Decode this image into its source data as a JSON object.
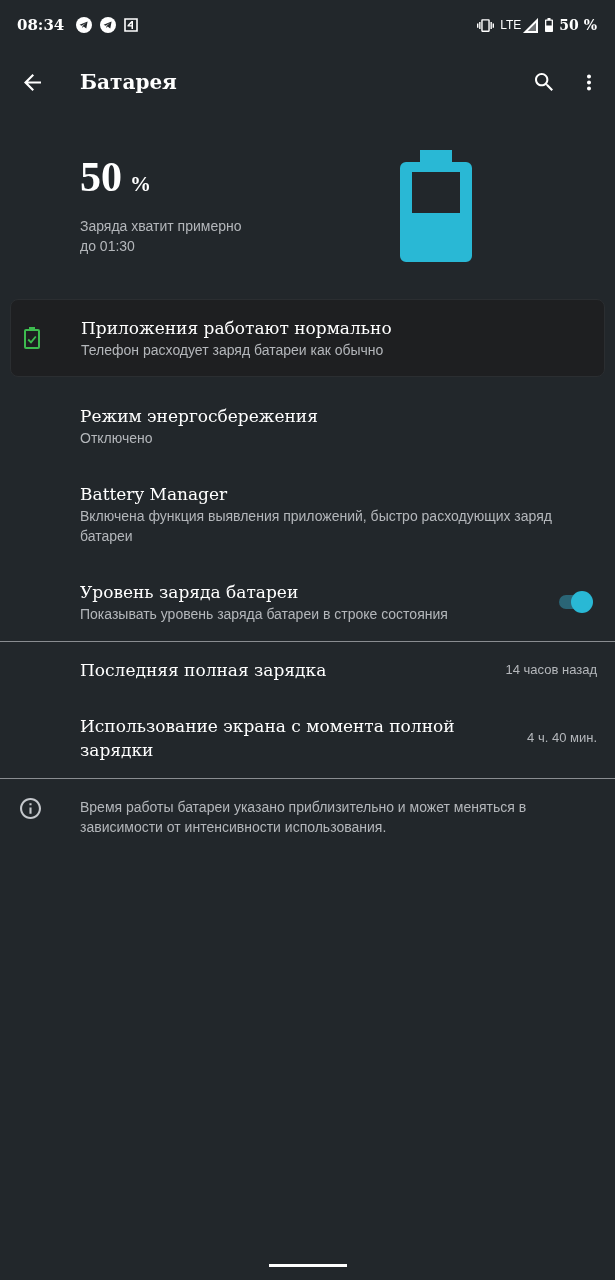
{
  "status_bar": {
    "time": "08:34",
    "network": "LTE",
    "battery": "50 %"
  },
  "toolbar": {
    "title": "Батарея"
  },
  "summary": {
    "percent": "50",
    "unit": "%",
    "estimate": "Заряда хватит примерно до 01:30"
  },
  "tip": {
    "title": "Приложения работают нормально",
    "subtitle": "Телефон расходует заряд батареи как обычно"
  },
  "settings": [
    {
      "kind": "item",
      "title": "Режим энергосбережения",
      "subtitle": "Отключено"
    },
    {
      "kind": "item",
      "title": "Battery Manager",
      "subtitle": "Включена функция выявления приложений, быстро расходующих заряд батареи"
    },
    {
      "kind": "toggle",
      "title": "Уровень заряда батареи",
      "subtitle": "Показывать уровень заряда батареи в строке состояния",
      "on": true
    }
  ],
  "usage": [
    {
      "title": "Последняя полная зарядка",
      "value": "14 часов назад"
    },
    {
      "title": "Использование экрана с момента полной зарядки",
      "value": "4 ч. 40 мин."
    }
  ],
  "footer": {
    "text": "Время работы батареи указано приблизительно и может меняться в зависимости от интенсивности использования."
  }
}
